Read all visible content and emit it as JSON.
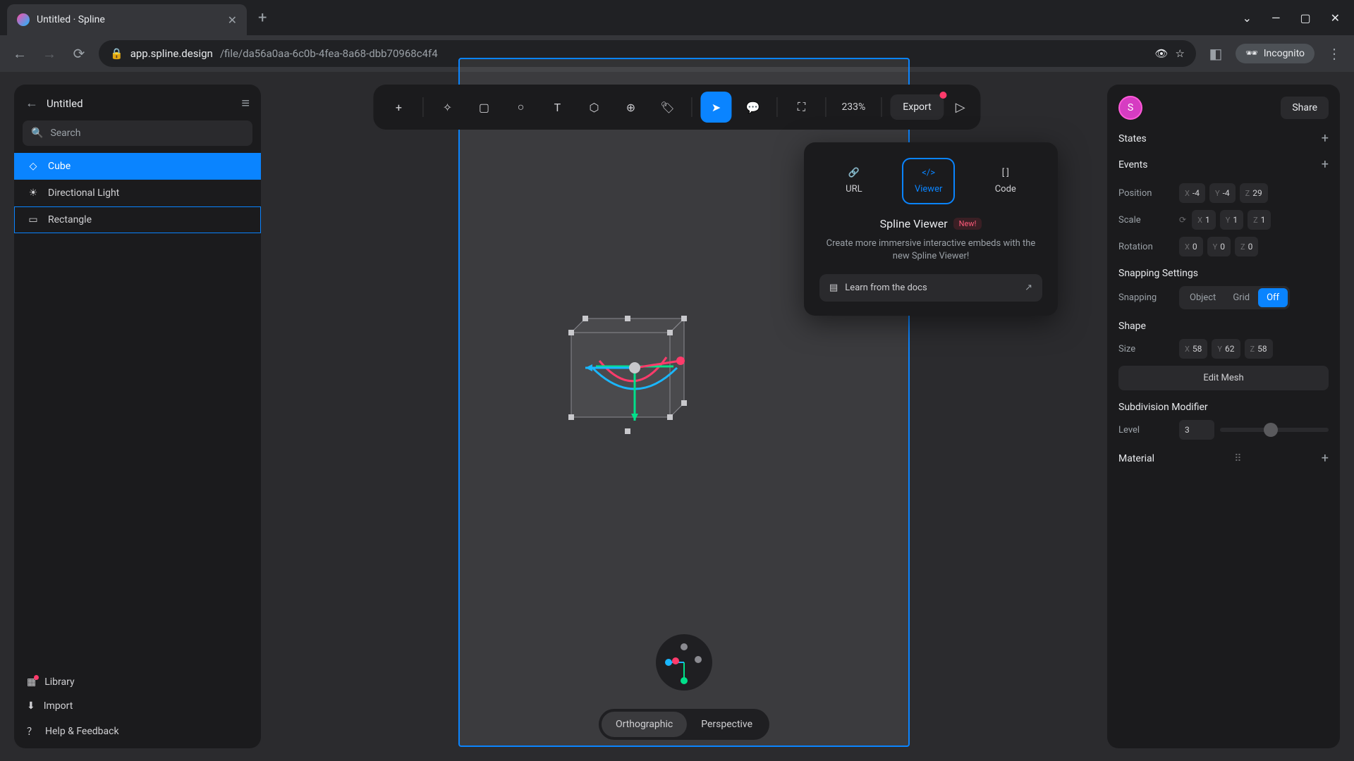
{
  "browser": {
    "tab_title": "Untitled · Spline",
    "url_domain": "app.spline.design",
    "url_path": "/file/da56a0aa-6c0b-4fea-8a68-dbb70968c4f4",
    "incognito_label": "Incognito"
  },
  "left": {
    "back_title": "Untitled",
    "search_placeholder": "Search",
    "layers": [
      {
        "name": "Cube",
        "icon": "cube",
        "selected": true
      },
      {
        "name": "Directional Light",
        "icon": "sun",
        "selected": false
      },
      {
        "name": "Rectangle",
        "icon": "rect",
        "selected": false,
        "outlined": true
      }
    ],
    "library": "Library",
    "import": "Import",
    "help": "Help & Feedback"
  },
  "toolbar": {
    "zoom": "233%",
    "export": "Export"
  },
  "popover": {
    "tabs": {
      "url": "URL",
      "viewer": "Viewer",
      "code": "Code"
    },
    "title": "Spline Viewer",
    "badge": "New!",
    "desc": "Create more immersive interactive embeds with the new Spline Viewer!",
    "learn": "Learn from the docs"
  },
  "right": {
    "avatar": "S",
    "share": "Share",
    "states": "States",
    "events": "Events",
    "position_label": "Position",
    "position": {
      "x": "-4",
      "y": "-4",
      "z": "29"
    },
    "scale_label": "Scale",
    "scale": {
      "x": "1",
      "y": "1",
      "z": "1"
    },
    "rotation_label": "Rotation",
    "rotation": {
      "x": "0",
      "y": "0",
      "z": "0"
    },
    "snapping_title": "Snapping Settings",
    "snapping_label": "Snapping",
    "snapping_opts": {
      "object": "Object",
      "grid": "Grid",
      "off": "Off"
    },
    "shape_title": "Shape",
    "size_label": "Size",
    "size": {
      "x": "58",
      "y": "62",
      "z": "58"
    },
    "edit_mesh": "Edit Mesh",
    "subdiv_title": "Subdivision Modifier",
    "level_label": "Level",
    "level_value": "3",
    "material_title": "Material"
  },
  "viewport": {
    "ortho": "Orthographic",
    "persp": "Perspective"
  }
}
